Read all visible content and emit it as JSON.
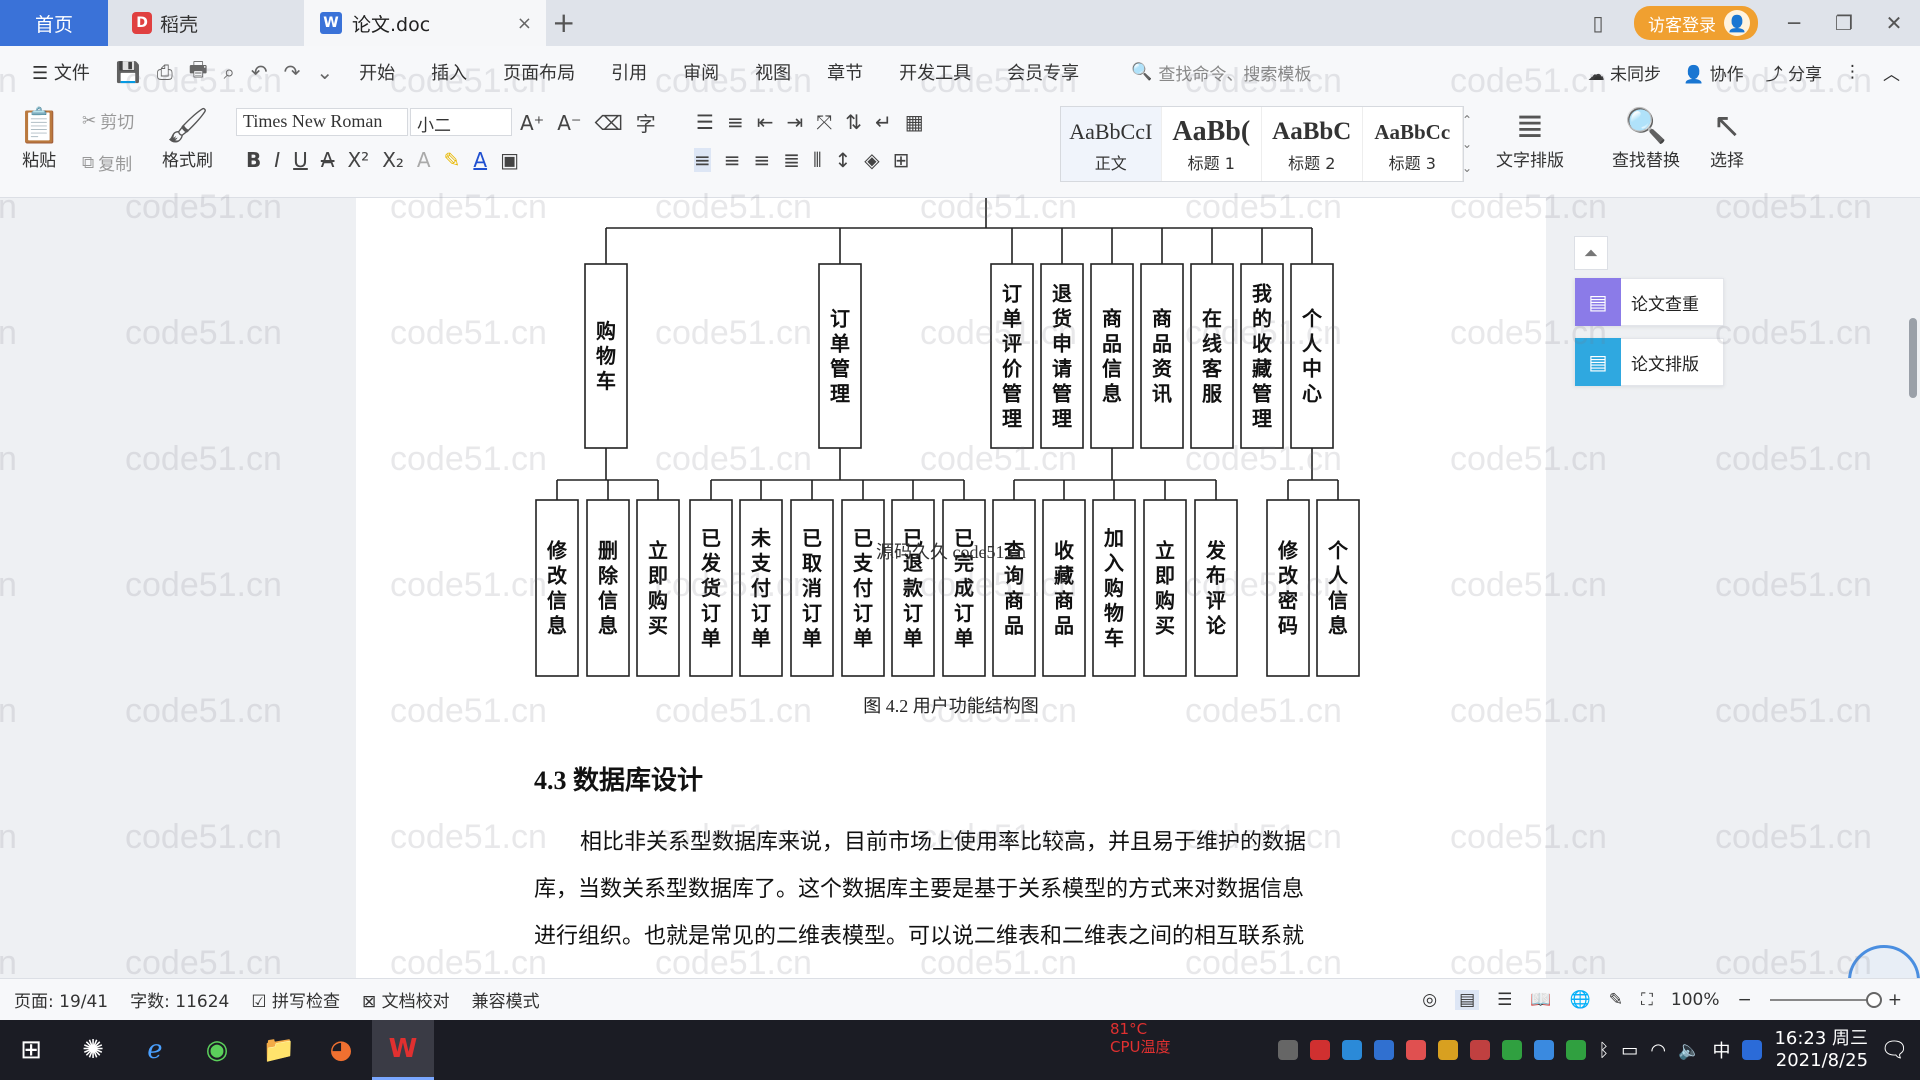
{
  "tabs": {
    "home": "首页",
    "daoke": "稻壳",
    "doc": "论文.doc",
    "new_tab": "+",
    "close": "×"
  },
  "titlebar": {
    "login": "访客登录",
    "avatar": "👤",
    "win_minimize": "─",
    "win_restore": "❐",
    "win_close": "✕",
    "sidebar_toggle": "▯"
  },
  "menu": {
    "file": "文件",
    "items": [
      "开始",
      "插入",
      "页面布局",
      "引用",
      "审阅",
      "视图",
      "章节",
      "开发工具",
      "会员专享"
    ],
    "active": "开始",
    "search_placeholder": "查找命令、搜索模板",
    "unsync": "未同步",
    "collab": "协作",
    "share": "分享"
  },
  "ribbon": {
    "paste": "粘贴",
    "cut": "剪切",
    "copy": "复制",
    "format_painter": "格式刷",
    "font_name": "Times New Roman",
    "font_size": "小二",
    "styles": [
      {
        "preview": "AaBbCcI",
        "name": "正文"
      },
      {
        "preview": "AaBb(",
        "name": "标题 1"
      },
      {
        "preview": "AaBbC",
        "name": "标题 2"
      },
      {
        "preview": "AaBbCc",
        "name": "标题 3"
      }
    ],
    "text_layout": "文字排版",
    "find_replace": "查找替换",
    "select": "选择"
  },
  "document": {
    "diagram": {
      "top_nodes": [
        "购物车",
        "订单管理",
        "订单评价管理",
        "退货申请管理",
        "商品信息",
        "商品资讯",
        "在线客服",
        "我的收藏管理",
        "个人中心"
      ],
      "bottom_nodes": [
        "修改信息",
        "删除信息",
        "立即购买",
        "已发货订单",
        "未支付订单",
        "已取消订单",
        "已支付订单",
        "已退款订单",
        "已完成订单",
        "查询商品",
        "收藏商品",
        "加入购物车",
        "立即购买",
        "发布评论",
        "修改密码",
        "个人信息"
      ]
    },
    "caption": "图 4.2  用户功能结构图",
    "overlay_watermark": "源码久久 code51.cn",
    "section_title": "4.3 数据库设计",
    "paragraph_lines": [
      "相比非关系型数据库来说，目前市场上使用率比较高，并且易于维护的数据",
      "库，当数关系型数据库了。这个数据库主要是基于关系模型的方式来对数据信息",
      "进行组织。也就是常见的二维表模型。可以说二维表和二维表之间的相互联系就"
    ]
  },
  "sidepanel": {
    "check": "论文查重",
    "format": "论文排版",
    "collapse": "⏶"
  },
  "status": {
    "page": "页面: 19/41",
    "words": "字数: 11624",
    "spell": "拼写检查",
    "proof": "文档校对",
    "compat": "兼容模式",
    "zoom": "100%"
  },
  "taskbar": {
    "time": "16:23 周三",
    "date": "2021/8/25",
    "ime": "中",
    "cpu_temp": "81°C",
    "cpu_label": "CPU温度"
  },
  "watermark_text": "code51.cn",
  "colors": {
    "accent": "#3a72d8",
    "login": "#f0a030"
  }
}
